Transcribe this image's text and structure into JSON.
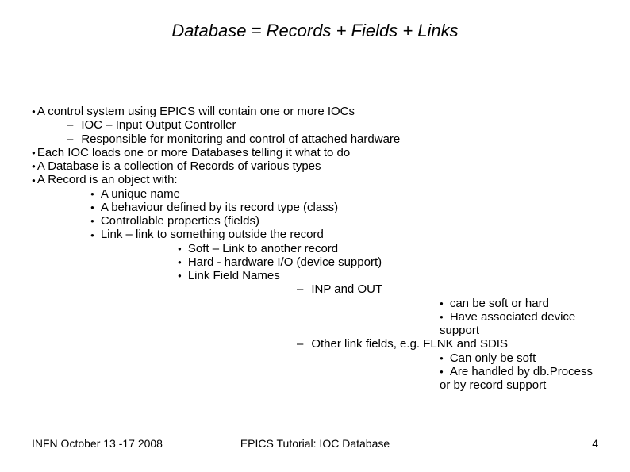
{
  "title": "Database = Records + Fields + Links",
  "b1": "A control system using EPICS will contain one or more IOCs",
  "b1a": "IOC – Input Output Controller",
  "b1b": "Responsible for monitoring and control of attached hardware",
  "b2": "Each IOC loads one or more Databases telling it what to do",
  "b3": "A Database is a collection of Records of various types",
  "b4": "A Record is an object with:",
  "b4a": "A unique name",
  "b4b": "A behaviour defined by its record type (class)",
  "b4c": "Controllable properties (fields)",
  "b4d": "Link – link to something outside the record",
  "b4d1": "Soft – Link to another record",
  "b4d2": "Hard - hardware I/O (device support)",
  "b4d3": "Link Field Names",
  "b4d3a": "INP and OUT",
  "b4d3a1": "can be soft or hard",
  "b4d3a2": "Have associated device support",
  "b4d3b": "Other link fields, e.g. FLNK and SDIS",
  "b4d3b1": "Can only be soft",
  "b4d3b2": "Are handled by db.Process or by record support",
  "footer_left": "INFN October 13 -17 2008",
  "footer_center": "EPICS Tutorial: IOC Database",
  "footer_right": "4"
}
